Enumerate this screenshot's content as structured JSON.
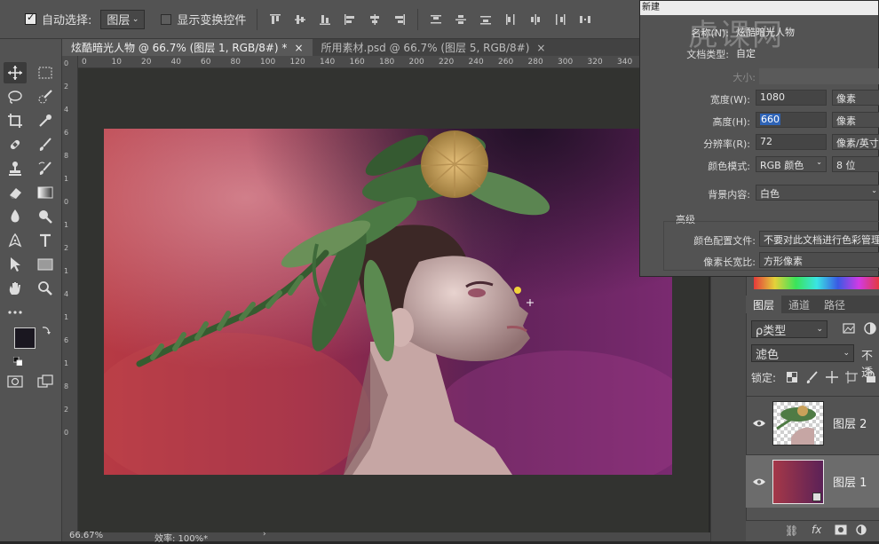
{
  "options_bar": {
    "auto_select_label": "自动选择:",
    "auto_select_value": "图层",
    "show_transform_label": "显示变换控件"
  },
  "tabs": [
    {
      "label": "炫酷暗光人物 @ 66.7% (图层 1, RGB/8#) *",
      "close": "×"
    },
    {
      "label": "所用素材.psd @ 66.7% (图层 5, RGB/8#)",
      "close": "×"
    }
  ],
  "ruler": {
    "h_ticks": [
      "0",
      "10",
      "20",
      "40",
      "60",
      "80",
      "100",
      "120",
      "140",
      "160",
      "180",
      "200",
      "220",
      "240",
      "260",
      "280",
      "300",
      "320",
      "340"
    ],
    "v_ticks": [
      "0",
      "2",
      "4",
      "6",
      "8",
      "1",
      "0",
      "1",
      "2",
      "1",
      "4",
      "1",
      "6",
      "1",
      "8",
      "2",
      "0"
    ]
  },
  "status": {
    "zoom": "66.67%",
    "info": "效率: 100%*"
  },
  "dialog": {
    "title": "新建",
    "name_label": "名称(N):",
    "name_value": "炫酷暗光人物",
    "doc_type_label": "文档类型:",
    "doc_type_value": "自定",
    "size_label": "大小:",
    "width_label": "宽度(W):",
    "width_value": "1080",
    "width_unit": "像素",
    "height_label": "高度(H):",
    "height_value": "660",
    "height_unit": "像素",
    "resolution_label": "分辨率(R):",
    "resolution_value": "72",
    "resolution_unit": "像素/英寸",
    "color_mode_label": "颜色模式:",
    "color_mode_value": "RGB 颜色",
    "bit_depth_value": "8 位",
    "bg_label": "背景内容:",
    "bg_value": "白色",
    "advanced_label": "高级",
    "color_profile_label": "颜色配置文件:",
    "color_profile_value": "不要对此文档进行色彩管理",
    "pixel_aspect_label": "像素长宽比:",
    "pixel_aspect_value": "方形像素"
  },
  "watermark": "虎课网",
  "layers_panel": {
    "tabs": [
      "图层",
      "通道",
      "路径"
    ],
    "filter_label": "ρ类型",
    "blend_mode": "滤色",
    "opacity_label": "不透",
    "lock_label": "锁定:",
    "layers": [
      {
        "name": "图层 2",
        "visible": true,
        "selected": false
      },
      {
        "name": "图层 1",
        "visible": true,
        "selected": true
      }
    ]
  },
  "colors": {
    "accent": "#2e63b6",
    "ui_bg": "#535353",
    "pasteboard": "#323330"
  }
}
